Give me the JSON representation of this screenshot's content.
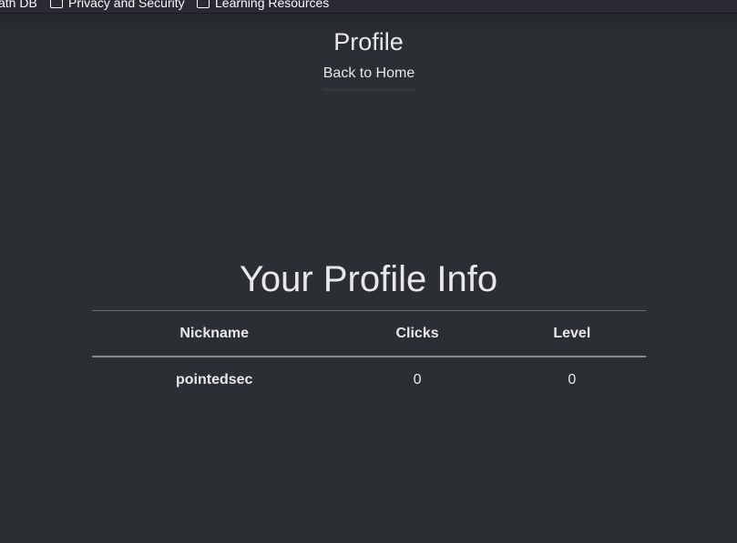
{
  "bookmarks": [
    {
      "label": "ath DB",
      "icon": "none"
    },
    {
      "label": "Privacy and Security",
      "icon": "folder-icon"
    },
    {
      "label": "Learning Resources",
      "icon": "folder-icon"
    }
  ],
  "header": {
    "title": "Profile",
    "back_link": "Back to Home"
  },
  "main": {
    "heading": "Your Profile Info",
    "table": {
      "columns": [
        "Nickname",
        "Clicks",
        "Level"
      ],
      "rows": [
        [
          "pointedsec",
          "0",
          "0"
        ]
      ]
    }
  },
  "colors": {
    "page_background": "#2b2e32",
    "text": "#e8e8e8",
    "bookmarks_bar": "#2b2a33"
  }
}
